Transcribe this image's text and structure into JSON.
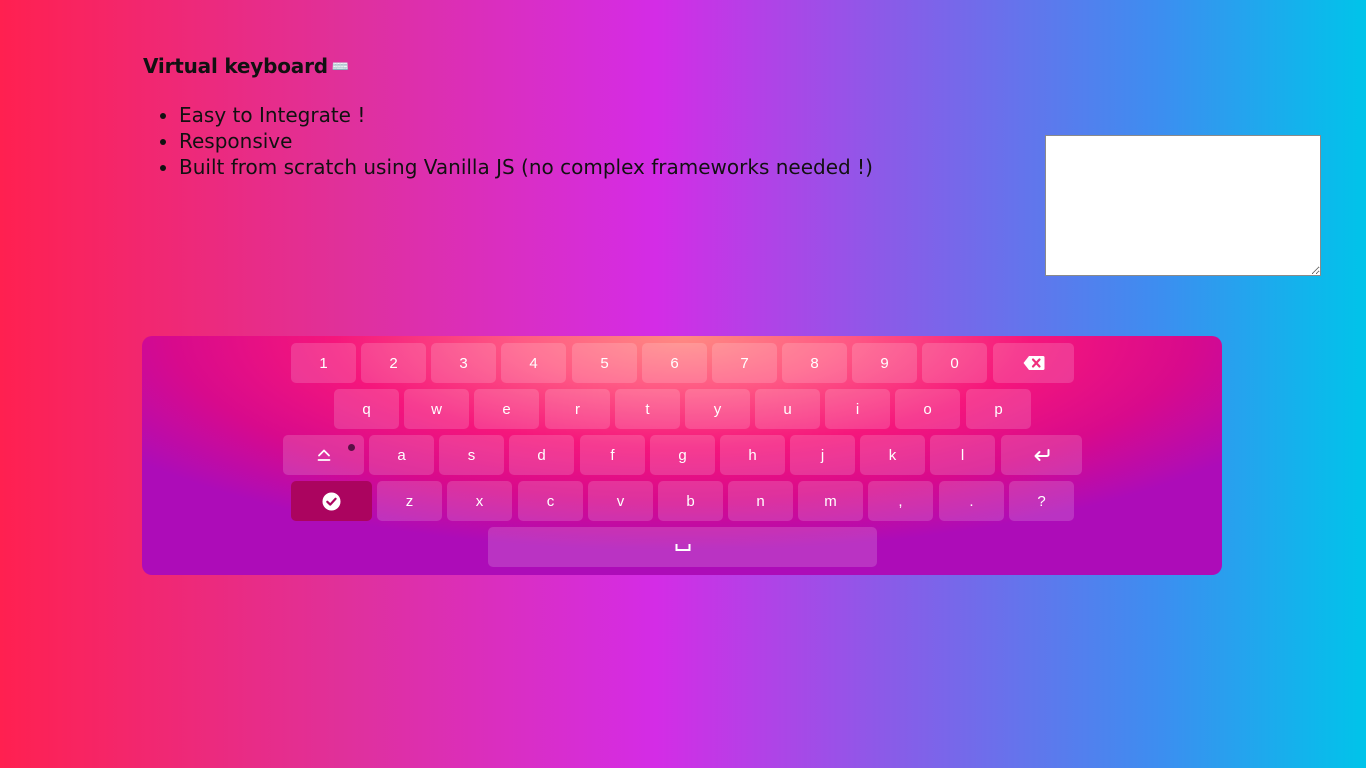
{
  "page": {
    "title": "Virtual keyboard",
    "title_emoji": "⌨️",
    "features": [
      "Easy to Integrate !",
      "Responsive",
      "Built from scratch using Vanilla JS (no complex frameworks needed !)"
    ]
  },
  "input": {
    "value": ""
  },
  "keyboard": {
    "rows": [
      [
        "1",
        "2",
        "3",
        "4",
        "5",
        "6",
        "7",
        "8",
        "9",
        "0",
        "backspace-icon"
      ],
      [
        "q",
        "w",
        "e",
        "r",
        "t",
        "y",
        "u",
        "i",
        "o",
        "p"
      ],
      [
        "caps-lock-icon",
        "a",
        "s",
        "d",
        "f",
        "g",
        "h",
        "j",
        "k",
        "l",
        "enter-icon"
      ],
      [
        "done-icon",
        "z",
        "x",
        "c",
        "v",
        "b",
        "n",
        "m",
        ",",
        ".",
        "?"
      ],
      [
        "space-icon"
      ]
    ],
    "caps_lock_active": false
  },
  "colors": {
    "done_key": "#ab045f",
    "key_text": "#ffffff"
  }
}
